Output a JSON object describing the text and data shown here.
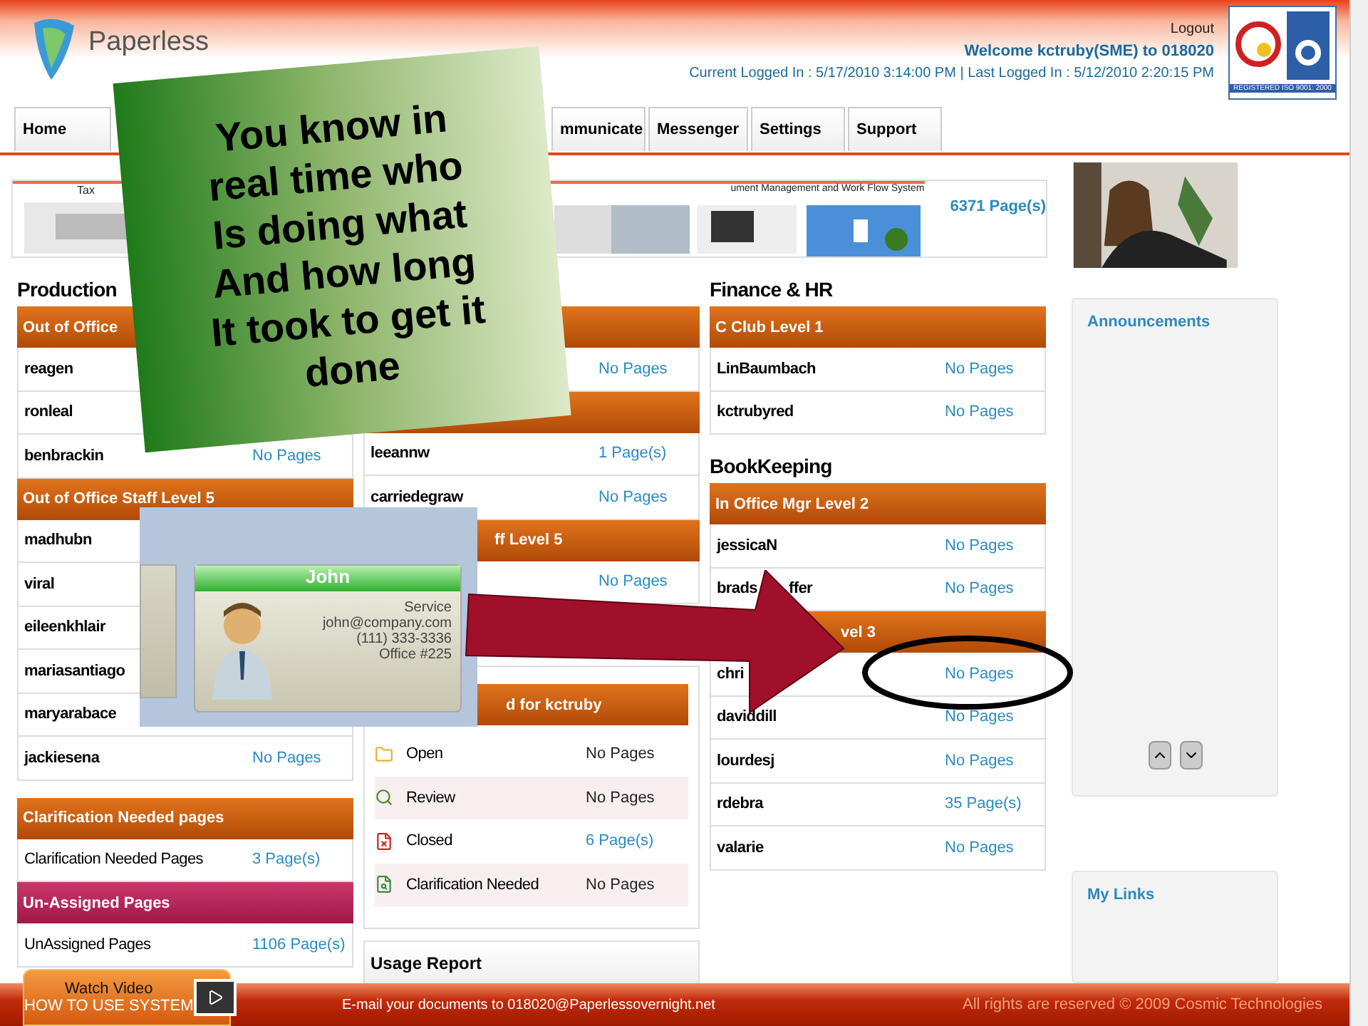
{
  "header": {
    "brand": "Paperless",
    "logout": "Logout",
    "welcome": "Welcome kctruby(SME) to 018020",
    "login_info": "Current Logged In : 5/17/2010 3:14:00 PM  | Last Logged In : 5/12/2010 2:20:15 PM",
    "badge_text": "REGISTERED ISO 9001: 2000"
  },
  "nav": [
    {
      "label": "Home"
    },
    {
      "label": "mmunicate"
    },
    {
      "label": "Messenger"
    },
    {
      "label": "Settings"
    },
    {
      "label": "Support"
    }
  ],
  "banner": {
    "caption_left": "Tax",
    "caption_right": "ument Management and Work Flow System",
    "count": "6371 Page(s)"
  },
  "columns": [
    {
      "groups": [
        {
          "title": "Production",
          "header": "Out of Office",
          "kind": "users",
          "rows": [
            {
              "name": "reagen"
            },
            {
              "name": "ronleal"
            },
            {
              "name": "benbrackin",
              "pages": "No Pages"
            }
          ]
        },
        {
          "header": "Out of Office Staff Level 5",
          "kind": "users",
          "rows": [
            {
              "name": "madhubn"
            },
            {
              "name": "viral"
            },
            {
              "name": "eileenkhlair"
            },
            {
              "name": "mariasantiago"
            },
            {
              "name": "maryarabace"
            },
            {
              "name": "jackiesena",
              "pages": "No Pages"
            }
          ]
        },
        {
          "header": "Clarification Needed pages",
          "kind": "summary",
          "rows": [
            {
              "name": "Clarification Needed Pages",
              "pages": "3 Page(s)"
            }
          ]
        },
        {
          "header": "Un-Assigned Pages",
          "kind": "unassigned",
          "rows": [
            {
              "name": "UnAssigned Pages",
              "pages": "1106 Page(s)"
            }
          ]
        }
      ]
    },
    {
      "groups": [
        {
          "kind": "users",
          "rows": [
            {
              "pages": "No Pages"
            }
          ]
        },
        {
          "kind": "users",
          "rows": [
            {
              "name": "leeannw",
              "pages": "1 Page(s)"
            },
            {
              "name": "carriedegraw",
              "pages": "No Pages"
            }
          ]
        },
        {
          "header": "ff Level 5",
          "cut_start": true,
          "kind": "users",
          "rows": [
            {
              "pages": "No Pages"
            }
          ]
        },
        {
          "header": "d for kctruby",
          "cut_start": true,
          "kind": "status",
          "items": [
            {
              "label": "Open",
              "pages": "No Pages",
              "linked": false
            },
            {
              "label": "Review",
              "pages": "No Pages",
              "linked": false
            },
            {
              "label": "Closed",
              "pages": "6 Page(s)",
              "linked": true
            },
            {
              "label": "Clarification Needed",
              "pages": "No Pages",
              "linked": false
            }
          ]
        },
        {
          "header": "Usage Report",
          "kind": "report"
        }
      ]
    },
    {
      "groups": [
        {
          "title": "Finance & HR",
          "header": "C Club Level 1",
          "kind": "users",
          "rows": [
            {
              "name": "LinBaumbach",
              "pages": "No Pages"
            },
            {
              "name": "kctrubyred",
              "pages": "No Pages"
            }
          ]
        },
        {
          "title": "BookKeeping",
          "header": "In Office Mgr Level 2",
          "kind": "users",
          "rows": [
            {
              "name": "jessicaN",
              "pages": "No Pages"
            },
            {
              "name": "brads",
              "name_tail": "ffer",
              "pages": "No Pages"
            }
          ]
        },
        {
          "header": "vel 3",
          "cut_start": true,
          "kind": "users",
          "rows": [
            {
              "name": "chri",
              "pages": "No Pages"
            },
            {
              "name": "daviddill",
              "pages": "No Pages"
            },
            {
              "name": "lourdesj",
              "pages": "No Pages"
            },
            {
              "name": "rdebra",
              "pages": "35 Page(s)"
            },
            {
              "name": "valarie",
              "pages": "No Pages"
            }
          ]
        }
      ]
    }
  ],
  "sidebar": {
    "announcements": "Announcements",
    "links": "My Links"
  },
  "footer": {
    "video_title": "Watch Video",
    "video_subtitle": "HOW TO USE SYSTEM",
    "email": "E-mail your  documents to 018020@Paperlessovernight.net",
    "copyright": "All rights are reserved © 2009 Cosmic Technologies"
  },
  "callout": {
    "lines": [
      "You know in",
      "real time who",
      "Is doing what",
      "And how long",
      "It took to get it",
      "done"
    ]
  },
  "contact_card": {
    "name": "John",
    "lines": [
      "Service",
      "john@company.com",
      "(111) 333-3336",
      "Office #225"
    ]
  }
}
